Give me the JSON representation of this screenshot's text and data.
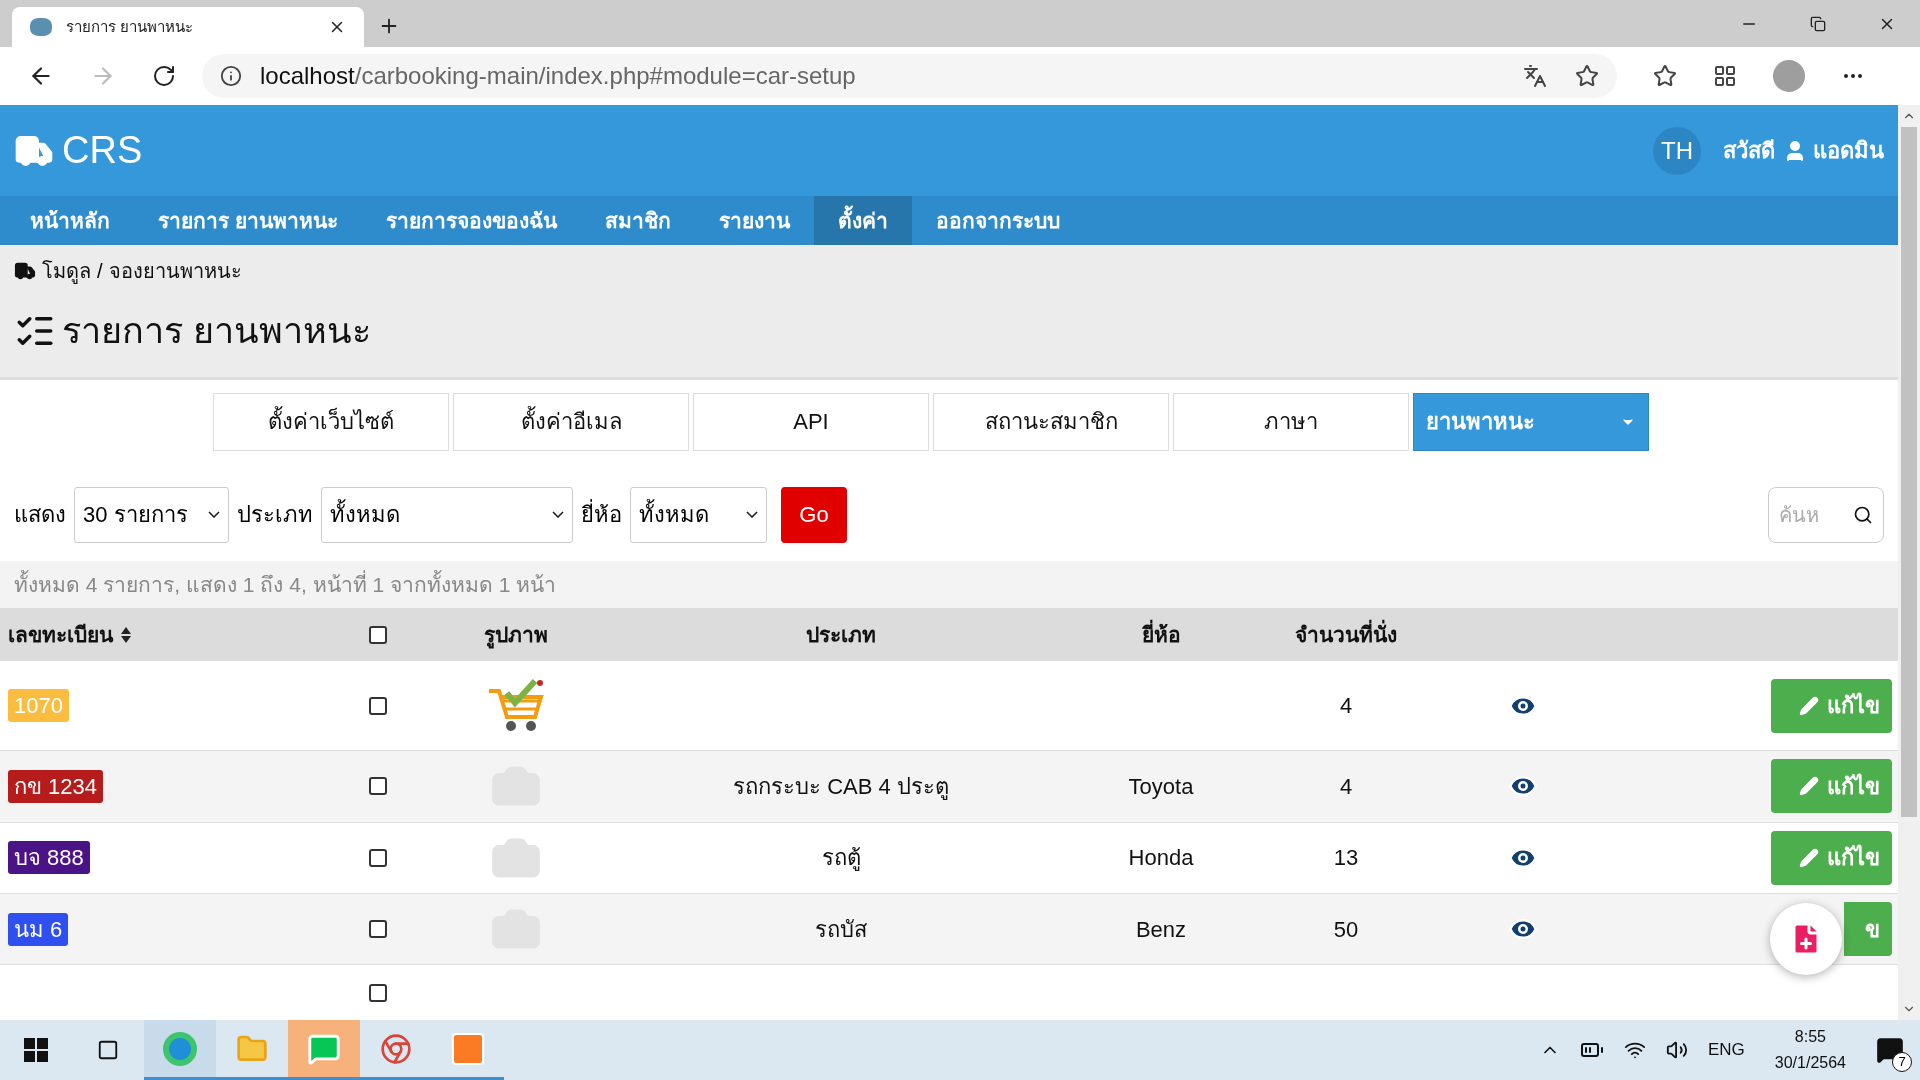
{
  "browser": {
    "tab_title": "รายการ ยานพาหนะ",
    "url_host": "localhost",
    "url_path": "/carbooking-main/index.php#module=car-setup"
  },
  "header": {
    "logo": "CRS",
    "language": "TH",
    "language_selected": true,
    "greeting": "สวัสดี",
    "user": "แอดมิน"
  },
  "nav": [
    {
      "label": "หน้าหลัก",
      "selected": false
    },
    {
      "label": "รายการ ยานพาหนะ",
      "selected": false
    },
    {
      "label": "รายการจองของฉัน",
      "selected": false
    },
    {
      "label": "สมาชิก",
      "selected": false
    },
    {
      "label": "รายงาน",
      "selected": false
    },
    {
      "label": "ตั้งค่า",
      "selected": true
    },
    {
      "label": "ออกจากระบบ",
      "selected": false
    }
  ],
  "breadcrumb": {
    "items": [
      "โมดูล",
      "จองยานพาหนะ"
    ],
    "separator": "/"
  },
  "page_title": "รายการ ยานพาหนะ",
  "settings_tabs": [
    {
      "label": "ตั้งค่าเว็บไซต์",
      "selected": false,
      "dropdown": false
    },
    {
      "label": "ตั้งค่าอีเมล",
      "selected": false,
      "dropdown": false
    },
    {
      "label": "API",
      "selected": false,
      "dropdown": false
    },
    {
      "label": "สถานะสมาชิก",
      "selected": false,
      "dropdown": false
    },
    {
      "label": "ภาษา",
      "selected": false,
      "dropdown": false
    },
    {
      "label": "ยานพาหนะ",
      "selected": true,
      "dropdown": true
    }
  ],
  "filters": {
    "show_label": "แสดง",
    "show_value": "30 รายการ",
    "type_label": "ประเภท",
    "type_value": "ทั้งหมด",
    "brand_label": "ยี่ห้อ",
    "brand_value": "ทั้งหมด",
    "go": "Go",
    "search_placeholder": "ค้นห"
  },
  "summary": "ทั้งหมด 4 รายการ, แสดง 1 ถึง 4, หน้าที่ 1 จากทั้งหมด 1 หน้า",
  "table": {
    "columns": [
      {
        "kind": "text",
        "label": "เลขทะเบียน",
        "sortable": true
      },
      {
        "kind": "checkbox",
        "checked": false
      },
      {
        "kind": "text",
        "label": "รูปภาพ",
        "sortable": false
      },
      {
        "kind": "text",
        "label": "ประเภท",
        "sortable": false
      },
      {
        "kind": "text",
        "label": "ยี่ห้อ",
        "sortable": false
      },
      {
        "kind": "text",
        "label": "จำนวนที่นั่ง",
        "sortable": false
      }
    ],
    "rows": [
      {
        "plate": "1070",
        "color": "#fbbd3f",
        "checked": false,
        "kind": "cart",
        "type": "",
        "brand": "",
        "seats": "4",
        "edit": "แก้ไข"
      },
      {
        "plate": "กข 1234",
        "color": "#b71c1c",
        "checked": false,
        "kind": "photo",
        "type": "รถกระบะ CAB 4 ประตู",
        "brand": "Toyota",
        "seats": "4",
        "edit": "แก้ไข"
      },
      {
        "plate": "บจ 888",
        "color": "#4a1486",
        "checked": false,
        "kind": "photo",
        "type": "รถตู้",
        "brand": "Honda",
        "seats": "13",
        "edit": "แก้ไข"
      },
      {
        "plate": "นม 6",
        "color": "#2f4ff0",
        "checked": false,
        "kind": "photo",
        "type": "รถบัส",
        "brand": "Benz",
        "seats": "50",
        "edit": "ข"
      }
    ],
    "footer_checkbox": {
      "checked": false
    }
  },
  "taskbar": {
    "language": "ENG",
    "time": "8:55",
    "date": "30/1/2564",
    "notifications": "7"
  }
}
